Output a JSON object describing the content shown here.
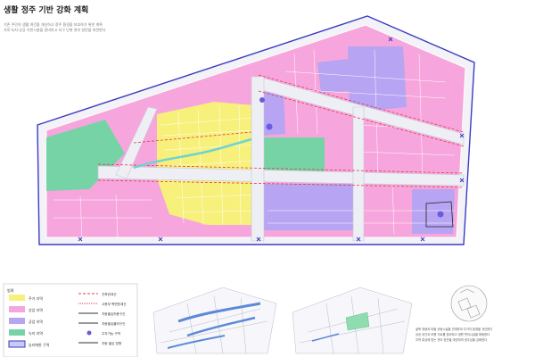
{
  "header": {
    "title": "생활 정주 기반 강화 계획",
    "lines": [
      "기존 주민의 생활 여건을 개선하고 정주 환경을 보호하기 위한 계획",
      "가로·녹지·공공 기반시설을 정비하고 지구 단위 관리 방안을 마련한다"
    ]
  },
  "legend": {
    "title": "범례",
    "left": [
      {
        "label": "주거 지역",
        "color": "#f7f07a"
      },
      {
        "label": "상업 지역",
        "color": "#f6a6dc"
      },
      {
        "label": "공업 지역",
        "color": "#b7a4f2"
      },
      {
        "label": "녹지 지역",
        "color": "#76d3a6"
      },
      {
        "label": "농리에한 구역",
        "color": "#c9c9f2"
      }
    ],
    "right": [
      "건축한계선",
      "고층부 벽면한계선",
      "차량출입허용구간",
      "차량출입불허구간",
      "주차가능 구역",
      "차량 출입 방향"
    ]
  },
  "colors": {
    "residential": "#f7f07a",
    "commercial": "#f6a6dc",
    "industrial": "#b7a4f2",
    "green": "#76d3a6",
    "road": "#eeeef5",
    "boundary": "#3b3bc4",
    "setback": "#e23a4a"
  },
  "caption": {
    "lines": [
      "골목 재생과 마을 공동시설을 연계하여 주거지 환경을 개선한다",
      "공공 공간과 보행 가로를 정비하고 생활 편의시설을 확충한다",
      "지역 특성에 맞는 관리 방안을 마련하여 정주성을 강화한다"
    ]
  }
}
